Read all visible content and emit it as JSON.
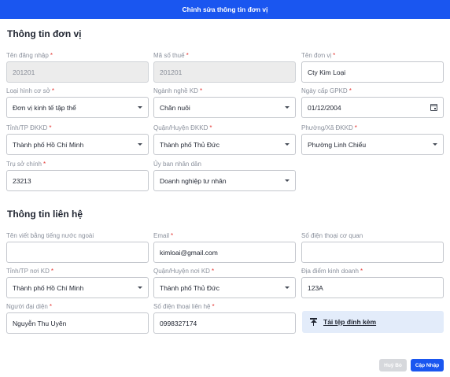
{
  "header": {
    "title": "Chỉnh sửa thông tin đơn vị"
  },
  "unit_section": {
    "title": "Thông tin đơn vị",
    "fields": {
      "username": {
        "label": "Tên đăng nhập",
        "value": "201201"
      },
      "tax_code": {
        "label": "Mã số thuế",
        "value": "201201"
      },
      "unit_name": {
        "label": "Tên đơn vị",
        "value": "Cty Kim Loại"
      },
      "facility_type": {
        "label": "Loại hình cơ sở",
        "value": "Đơn vị kinh tế tập thể"
      },
      "business_line": {
        "label": "Ngành nghề KD",
        "value": "Chăn nuôi"
      },
      "license_date": {
        "label": "Ngày cấp GPKD",
        "value": "01/12/2004"
      },
      "province": {
        "label": "Tỉnh/TP ĐKKD",
        "value": "Thành phố Hồ Chí Minh"
      },
      "district": {
        "label": "Quận/Huyện ĐKKD",
        "value": "Thành phố Thủ Đức"
      },
      "ward": {
        "label": "Phường/Xã ĐKKD",
        "value": "Phường Linh Chiểu"
      },
      "headquarters": {
        "label": "Trụ sở chính",
        "value": "23213"
      },
      "peoples_committee": {
        "label": "Ủy ban nhân dân",
        "value": "Doanh nghiệp tư nhân"
      }
    }
  },
  "contact_section": {
    "title": "Thông tin liên hệ",
    "fields": {
      "foreign_name": {
        "label": "Tên viết bằng tiếng nước ngoài",
        "value": ""
      },
      "email": {
        "label": "Email",
        "value": "kimloai@gmail.com"
      },
      "office_phone": {
        "label": "Số điện thoại cơ quan",
        "value": ""
      },
      "biz_province": {
        "label": "Tỉnh/TP nơi KD",
        "value": "Thành phố Hồ Chí Minh"
      },
      "biz_district": {
        "label": "Quận/Huyện nơi KD",
        "value": "Thành phố Thủ Đức"
      },
      "biz_location": {
        "label": "Địa điểm kinh doanh",
        "value": "123A"
      },
      "representative": {
        "label": "Người đại diện",
        "value": "Nguyễn Thu Uyên"
      },
      "contact_phone": {
        "label": "Số điện thoại liên hệ",
        "value": "0998327174"
      }
    },
    "upload_label": "Tải tệp đính kèm"
  },
  "actions": {
    "cancel_label": "Huỷ Bỏ",
    "submit_label": "Cập Nhập"
  },
  "colors": {
    "primary": "#1a56f0",
    "required": "#e53935",
    "upload_bg": "#e3ecfa"
  }
}
